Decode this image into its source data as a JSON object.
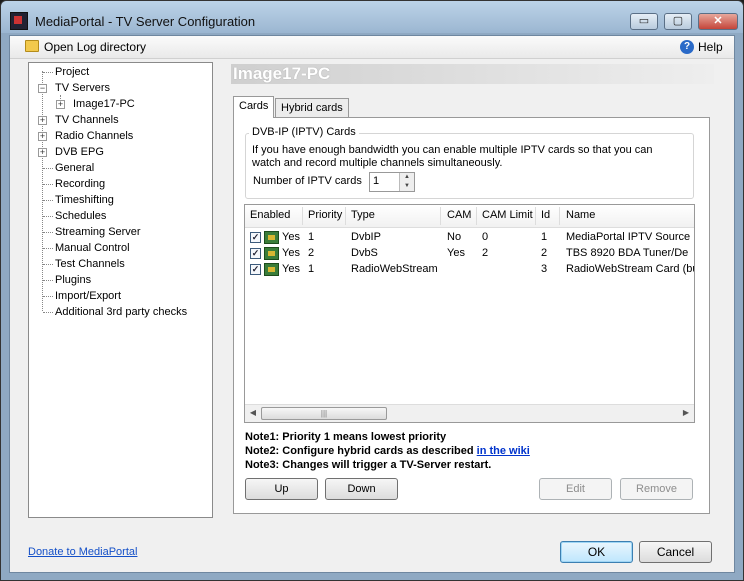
{
  "window": {
    "title": "MediaPortal - TV Server Configuration",
    "min_glyph": "▭",
    "max_glyph": "▢",
    "close_glyph": "✕"
  },
  "menu": {
    "open_log": "Open Log directory",
    "help_glyph": "?",
    "help": "Help"
  },
  "tree": {
    "items": [
      {
        "label": "Project"
      },
      {
        "label": "TV Servers"
      },
      {
        "label": "Image17-PC"
      },
      {
        "label": "TV Channels"
      },
      {
        "label": "Radio Channels"
      },
      {
        "label": "DVB EPG"
      },
      {
        "label": "General"
      },
      {
        "label": "Recording"
      },
      {
        "label": "Timeshifting"
      },
      {
        "label": "Schedules"
      },
      {
        "label": "Streaming Server"
      },
      {
        "label": "Manual Control"
      },
      {
        "label": "Test Channels"
      },
      {
        "label": "Plugins"
      },
      {
        "label": "Import/Export"
      },
      {
        "label": "Additional 3rd party checks"
      }
    ],
    "expanded_glyph": "−",
    "collapsed_glyph": "+"
  },
  "panel": {
    "header": "Image17-PC",
    "tabs": [
      {
        "label": "Cards"
      },
      {
        "label": "Hybrid cards"
      }
    ],
    "iptv": {
      "group_title": "DVB-IP (IPTV) Cards",
      "description": "If you have enough bandwidth you can enable multiple IPTV cards so that you can watch and record multiple channels simultaneously.",
      "count_label": "Number of IPTV cards",
      "count_value": "1",
      "spin_up": "▲",
      "spin_down": "▼"
    },
    "cards_table": {
      "columns": [
        "Enabled",
        "Priority",
        "Type",
        "CAM",
        "CAM Limit",
        "Id",
        "Name"
      ],
      "check_glyph": "✓",
      "rows": [
        {
          "enabled": "Yes",
          "priority": "1",
          "type": "DvbIP",
          "cam": "No",
          "cam_limit": "0",
          "id": "1",
          "name": "MediaPortal IPTV Source"
        },
        {
          "enabled": "Yes",
          "priority": "2",
          "type": "DvbS",
          "cam": "Yes",
          "cam_limit": "2",
          "id": "2",
          "name": "TBS 8920 BDA Tuner/De"
        },
        {
          "enabled": "Yes",
          "priority": "1",
          "type": "RadioWebStream",
          "cam": "",
          "cam_limit": "",
          "id": "3",
          "name": "RadioWebStream Card (bu"
        }
      ],
      "scroll_left": "◀",
      "scroll_right": "▶",
      "thumb_grip": "|||"
    },
    "notes": {
      "note1": "Note1: Priority 1 means lowest priority",
      "note2": "Note2: Configure hybrid cards as described ",
      "note2_link": "in the wiki",
      "note3": "Note3: Changes will trigger a TV-Server restart."
    },
    "buttons": {
      "up": "Up",
      "down": "Down",
      "edit": "Edit",
      "remove": "Remove"
    }
  },
  "footer": {
    "donate": "Donate to MediaPortal",
    "ok": "OK",
    "cancel": "Cancel"
  }
}
